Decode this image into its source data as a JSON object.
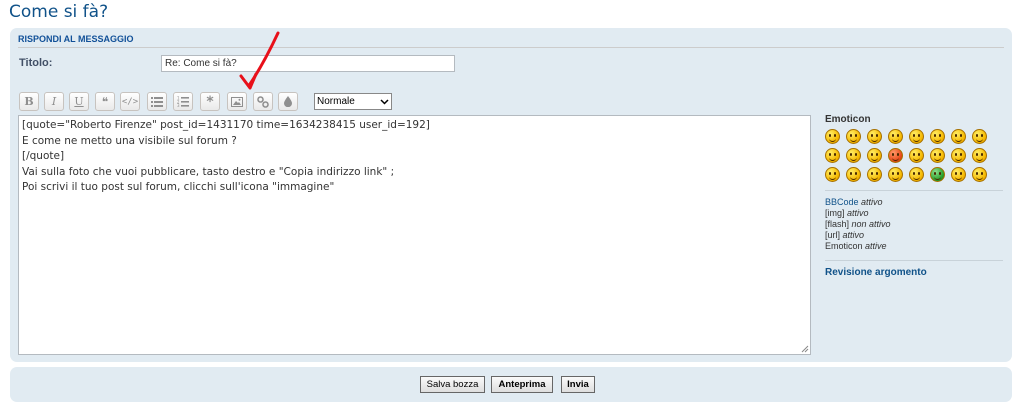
{
  "page": {
    "title": "Come si fà?"
  },
  "form": {
    "heading": "RISPONDI AL MESSAGGIO",
    "title_label": "Titolo:",
    "title_value": "Re: Come si fà?",
    "font_size_selected": "Normale",
    "message_text": "[quote=\"Roberto Firenze\" post_id=1431170 time=1634238415 user_id=192]\nE come ne metto una visibile sul forum ?\n[/quote]\nVai sulla foto che vuoi pubblicare, tasto destro e \"Copia indirizzo link\" ;\nPoi scrivi il tuo post sul forum, clicchi sull'icona \"immagine\""
  },
  "toolbar": {
    "bold": "B",
    "italic": "I",
    "underline": "U",
    "quote": "❝",
    "code": "</>",
    "list": "list-icon",
    "numbered": "numbered-list-icon",
    "star": "*",
    "image": "image-icon",
    "link": "link-icon",
    "color": "drop-icon"
  },
  "sidebar": {
    "emoticon_title": "Emoticon",
    "bbcode": "BBCode",
    "bbcode_state": "attivo",
    "img": "[img]",
    "img_state": "attivo",
    "flash": "[flash]",
    "flash_state": "non attivo",
    "url": "[url]",
    "url_state": "attivo",
    "emoticon": "Emoticon",
    "emoticon_state": "attive",
    "topic_review": "Revisione argomento"
  },
  "buttons": {
    "save_draft": "Salva bozza",
    "preview": "Anteprima",
    "submit": "Invia"
  },
  "annotation": {
    "arrow_color": "#e8101a"
  }
}
